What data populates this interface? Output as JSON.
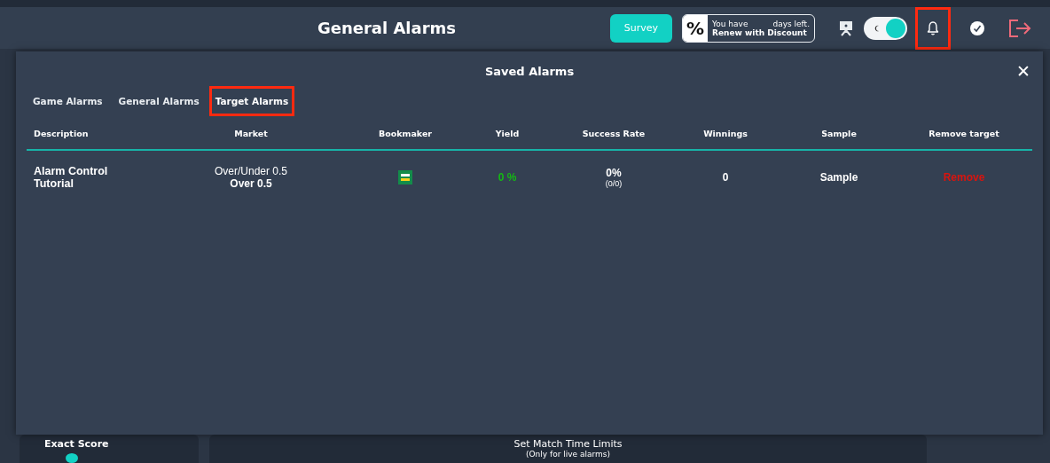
{
  "header": {
    "title": "General Alarms",
    "survey_button": "Survey",
    "promo": {
      "badge": "%",
      "line_1": "You have",
      "line_2": "days left.",
      "line_3": "Renew with Discount"
    },
    "dark_mode_toggle": {
      "on": true
    },
    "bell_highlighted": true
  },
  "modal": {
    "title": "Saved Alarms",
    "close": "✕",
    "tabs": [
      {
        "label": "Game Alarms",
        "selected": false,
        "highlighted": false
      },
      {
        "label": "General Alarms",
        "selected": false,
        "highlighted": false
      },
      {
        "label": "Target Alarms",
        "selected": true,
        "highlighted": true
      }
    ],
    "table": {
      "columns": [
        "Description",
        "Market",
        "Bookmaker",
        "Yield",
        "Success Rate",
        "Winnings",
        "Sample",
        "Remove target"
      ],
      "rows": [
        {
          "description": "Alarm Control Tutorial",
          "market": "Over/Under 0.5",
          "selection": "Over 0.5",
          "bookmaker": {
            "kind": "logo"
          },
          "yield": "0 %",
          "success_rate": "0%",
          "success_count": "(0/0)",
          "winnings": "0",
          "sample": "Sample",
          "remove": "Remove"
        }
      ]
    }
  },
  "background": {
    "left_card": {
      "title": "Exact Score"
    },
    "middle_card": {
      "title": "Set Match Time Limits",
      "subtitle": "(Only for live alarms)"
    }
  }
}
